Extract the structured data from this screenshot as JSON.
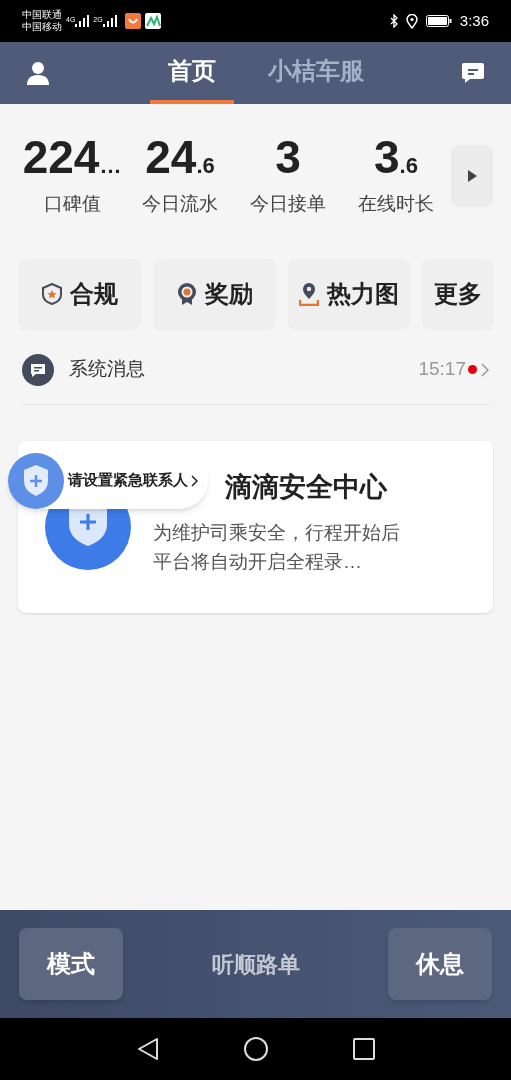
{
  "status_bar": {
    "carriers": [
      "中国联通",
      "中国移动"
    ],
    "networks": [
      "4G",
      "2G"
    ],
    "time": "3:36"
  },
  "header": {
    "tabs": [
      {
        "label": "首页",
        "selected": true
      },
      {
        "label": "小桔车服",
        "selected": false
      }
    ]
  },
  "stats": [
    {
      "value": "224",
      "suffix": "…",
      "label": "口碑值"
    },
    {
      "value": "24",
      "suffix": ".6",
      "label": "今日流水"
    },
    {
      "value": "3",
      "label": "今日接单"
    },
    {
      "value": "3",
      "suffix": ".6",
      "label": "在线时长"
    }
  ],
  "shortcuts": [
    {
      "label": "合规",
      "kind": "shield"
    },
    {
      "label": "奖励",
      "kind": "medal"
    },
    {
      "label": "热力图",
      "kind": "pin"
    },
    {
      "label": "更多",
      "kind": "none"
    }
  ],
  "message": {
    "title": "系统消息",
    "time": "15:17",
    "unread": true
  },
  "card": {
    "title": "滴滴安全中心",
    "text": "为维护司乘安全，行程开始后平台将自动开启全程录…",
    "tooltip": "请设置紧急联系人"
  },
  "bottom_bar": {
    "left": "模式",
    "center": "听顺路单",
    "right": "休息"
  }
}
